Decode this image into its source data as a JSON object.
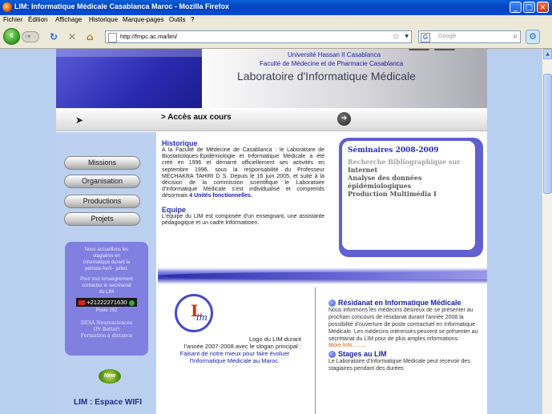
{
  "window": {
    "title": "LIM: Informatique Médicale Casablanca Maroc - Mozilla Firefox",
    "buttons": [
      "_",
      "□",
      "×"
    ]
  },
  "menu": [
    "Fichier",
    "Édition",
    "Affichage",
    "Historique",
    "Marque-pages",
    "Outils",
    "?"
  ],
  "nav": {
    "url": "http://fmpc.ac.ma/lim/",
    "search_placeholder": "Google",
    "search_engine_letter": "G"
  },
  "header": {
    "university": "Université Hassan II Casablanca",
    "faculty": "Faculté de Médecine et de Pharmacie Casablanca",
    "lab": "Laboratoire d'Informatique Médicale"
  },
  "access_bar": {
    "label": "> Accès aux cours"
  },
  "sidebar": {
    "buttons": [
      "Missions",
      "Organisation",
      "Productions",
      "Projets"
    ],
    "notice": {
      "line1": "Nous accueillons les",
      "line2": "stagiaires en",
      "line3": "Informatique durant la",
      "line4": "période Avril - juillet.",
      "line5": "Pour tout renseignement",
      "line6": "contactez le secrétariat",
      "line7": "du LIM",
      "phone": "+21222271630",
      "poste": "Poste 292",
      "desa": "DESA Neurosciences",
      "pr": "(Pr Bettar)",
      "formation": "Formation à distance"
    },
    "new_badge": "New",
    "wifi": "LIM : Espace WIFI"
  },
  "historique": {
    "title": "Historique",
    "text": "A la Faculté de Médecine de Casablanca : le Laboratoire de Biostatistiques-Epidémiologie et Informatique Médicale a été créé en 1996 et démarré officiellement ses activités en septembre 1996, sous la responsabilité du Professeur MECHAKRA TAHIRI D S. Depuis le 16 juin 2005, et suite à la décision de la commission scientifique le Laboratoire d'Informatique Médicale s'est individualisé et comprends désormais",
    "highlight": "4 Unités fonctionnelles."
  },
  "equipe": {
    "title": "Equipe",
    "text": "L'équipe du LIM est composée d'un enseignant, une assistante pédagogique et un cadre Informaticien."
  },
  "seminaires": {
    "title": "Séminaires 2008-2009",
    "items": [
      "Recherche Bibliographique sur",
      "Internet",
      "Analyse des données",
      "épidémiologiques",
      "Production Multimédia I"
    ]
  },
  "logo": {
    "letter": "L",
    "word": "im",
    "caption1": "Logo du LIM durant",
    "caption2": "l'année 2007-2008 avec le slogan principal :",
    "slogan1": "Faisant de notre mieux pour faire évoluer",
    "slogan2": "l'Informatique Médicale au Maroc."
  },
  "residanat": {
    "title": "Résidanat en Informatique Médicale",
    "text": "Nous informons les médecins désireux de se présenter au prochain concours de résidanat durant l'année 2008 la possibilité d'ouverture de poste contractuel en Informatique Médicale. Les médecins intéressés peuvent se présenter au secrétariat du LIM pour de plus amples informations.",
    "more": "More Info........."
  },
  "stages": {
    "title": "Stages au LIM",
    "text": "Le Laboratoire d'Informatique Médicale peut recevoir des stagiaires pendant des durées"
  },
  "colors": {
    "accent": "#2a2ab8",
    "titlebar": "#0a4ad0",
    "sidebar_bg": "#bcd0f0"
  }
}
